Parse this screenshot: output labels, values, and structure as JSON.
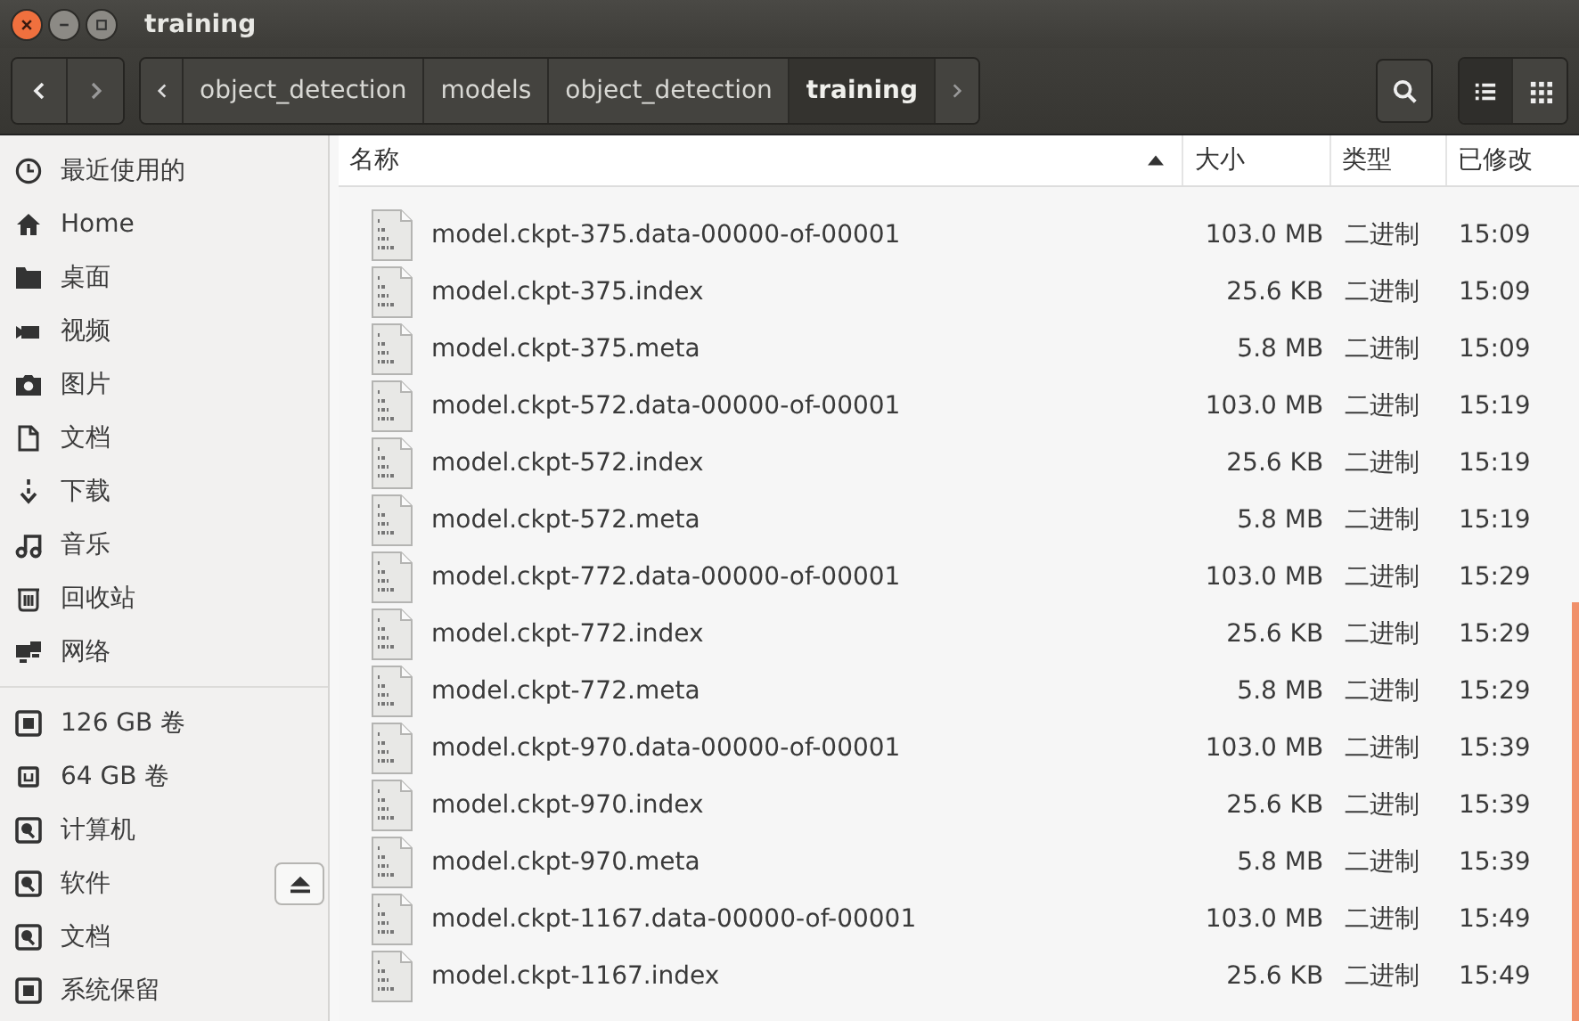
{
  "window": {
    "title": "training"
  },
  "breadcrumbs": [
    {
      "label": "object_detection",
      "selected": false
    },
    {
      "label": "models",
      "selected": false
    },
    {
      "label": "object_detection",
      "selected": false
    },
    {
      "label": "training",
      "selected": true
    }
  ],
  "view_buttons": [
    {
      "kind": "list",
      "selected": true
    },
    {
      "kind": "grid",
      "selected": false
    }
  ],
  "sidebar": {
    "places": [
      {
        "label": "最近使用的"
      },
      {
        "label": "Home"
      },
      {
        "label": "桌面"
      },
      {
        "label": "视频"
      },
      {
        "label": "图片"
      },
      {
        "label": "文档"
      },
      {
        "label": "下载"
      },
      {
        "label": "音乐"
      },
      {
        "label": "回收站"
      },
      {
        "label": "网络"
      }
    ],
    "devices": [
      {
        "label": "126 GB 卷",
        "ejectable": false
      },
      {
        "label": "64 GB 卷",
        "ejectable": false
      },
      {
        "label": "计算机",
        "ejectable": false
      },
      {
        "label": "软件",
        "ejectable": true
      },
      {
        "label": "文档",
        "ejectable": false
      },
      {
        "label": "系统保留",
        "ejectable": false
      }
    ]
  },
  "table": {
    "columns": [
      {
        "label": "名称",
        "sorted": true
      },
      {
        "label": "大小",
        "sorted": false
      },
      {
        "label": "类型",
        "sorted": false
      },
      {
        "label": "已修改",
        "sorted": false
      }
    ],
    "rows": [
      {
        "name": "model.ckpt-375.data-00000-of-00001",
        "size": "103.0 MB",
        "type": "二进制",
        "modified": "15:09"
      },
      {
        "name": "model.ckpt-375.index",
        "size": "25.6 KB",
        "type": "二进制",
        "modified": "15:09"
      },
      {
        "name": "model.ckpt-375.meta",
        "size": "5.8 MB",
        "type": "二进制",
        "modified": "15:09"
      },
      {
        "name": "model.ckpt-572.data-00000-of-00001",
        "size": "103.0 MB",
        "type": "二进制",
        "modified": "15:19"
      },
      {
        "name": "model.ckpt-572.index",
        "size": "25.6 KB",
        "type": "二进制",
        "modified": "15:19"
      },
      {
        "name": "model.ckpt-572.meta",
        "size": "5.8 MB",
        "type": "二进制",
        "modified": "15:19"
      },
      {
        "name": "model.ckpt-772.data-00000-of-00001",
        "size": "103.0 MB",
        "type": "二进制",
        "modified": "15:29"
      },
      {
        "name": "model.ckpt-772.index",
        "size": "25.6 KB",
        "type": "二进制",
        "modified": "15:29"
      },
      {
        "name": "model.ckpt-772.meta",
        "size": "5.8 MB",
        "type": "二进制",
        "modified": "15:29"
      },
      {
        "name": "model.ckpt-970.data-00000-of-00001",
        "size": "103.0 MB",
        "type": "二进制",
        "modified": "15:39"
      },
      {
        "name": "model.ckpt-970.index",
        "size": "25.6 KB",
        "type": "二进制",
        "modified": "15:39"
      },
      {
        "name": "model.ckpt-970.meta",
        "size": "5.8 MB",
        "type": "二进制",
        "modified": "15:39"
      },
      {
        "name": "model.ckpt-1167.data-00000-of-00001",
        "size": "103.0 MB",
        "type": "二进制",
        "modified": "15:49"
      },
      {
        "name": "model.ckpt-1167.index",
        "size": "25.6 KB",
        "type": "二进制",
        "modified": "15:49"
      }
    ]
  }
}
